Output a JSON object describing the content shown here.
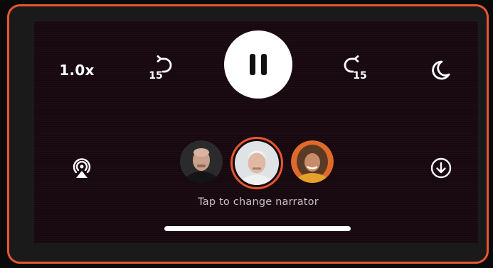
{
  "player": {
    "speed_label": "1.0x",
    "skip_back_seconds": "15",
    "skip_forward_seconds": "15",
    "state": "playing",
    "narrator_hint": "Tap to change narrator",
    "narrators": [
      {
        "selected": false
      },
      {
        "selected": true
      },
      {
        "selected": false
      }
    ]
  },
  "colors": {
    "accent": "#e8572e",
    "panel_bg": "#180910",
    "frame_bg": "#1a1a1a",
    "text_primary": "#ffffff",
    "text_secondary": "#c9c0c4"
  },
  "icons": {
    "play_pause": "pause-icon",
    "skip_back": "skip-back-icon",
    "skip_forward": "skip-forward-icon",
    "sleep_timer": "moon-icon",
    "output": "airplay-icon",
    "download": "download-icon"
  }
}
